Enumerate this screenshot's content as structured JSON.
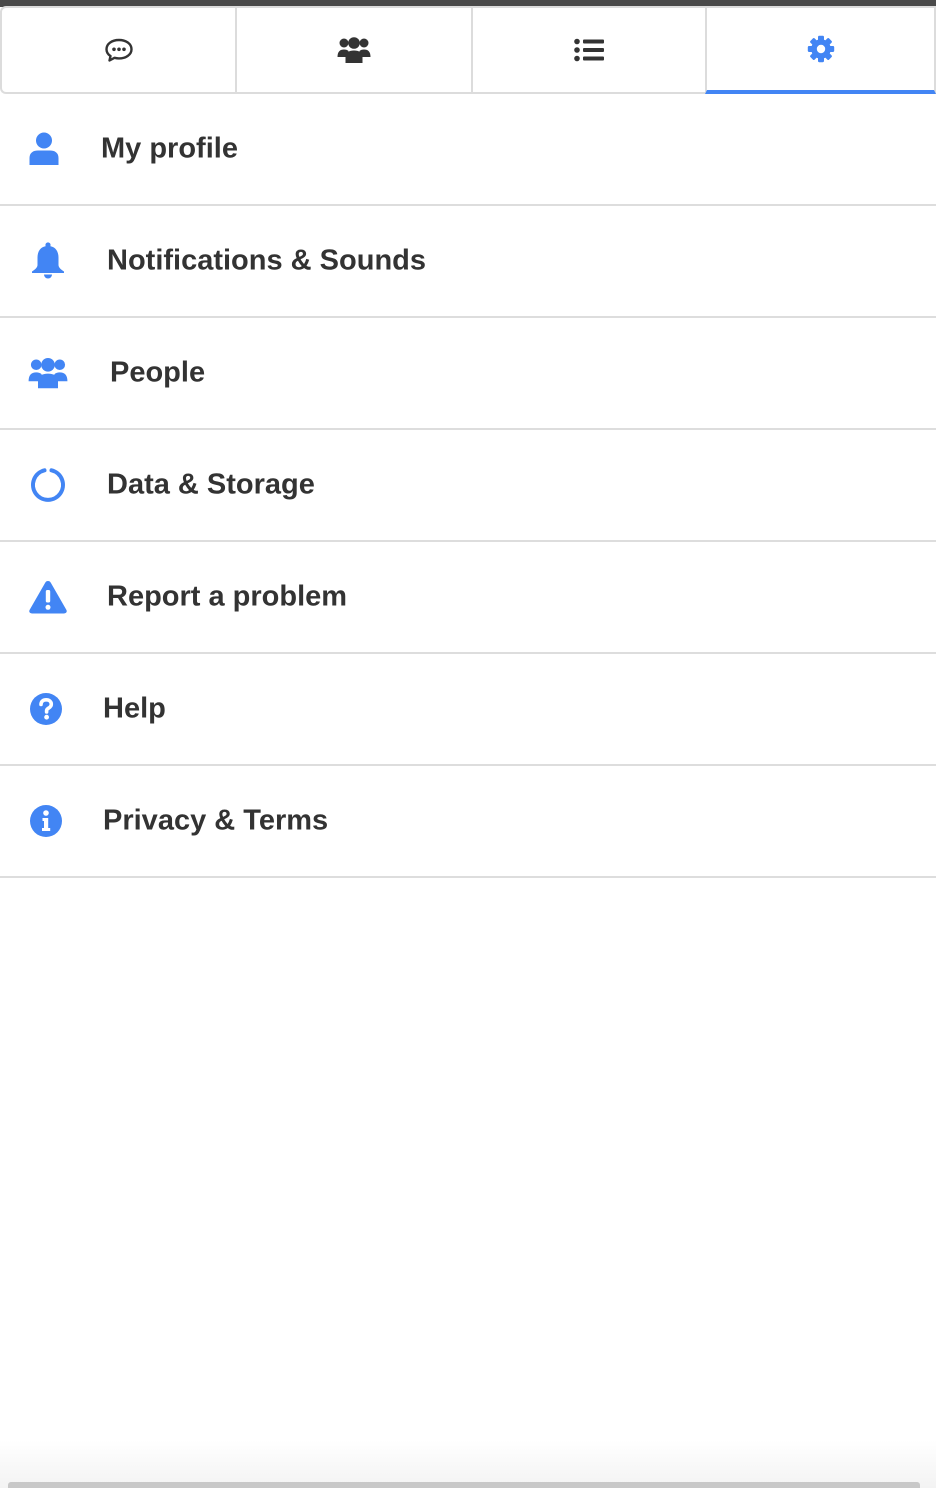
{
  "tabs": [
    {
      "icon": "chat-bubble-icon",
      "active": false
    },
    {
      "icon": "users-icon",
      "active": false
    },
    {
      "icon": "list-icon",
      "active": false
    },
    {
      "icon": "gear-icon",
      "active": true
    }
  ],
  "menu": {
    "items": [
      {
        "icon": "user-icon",
        "label": "My profile"
      },
      {
        "icon": "bell-icon",
        "label": "Notifications & Sounds"
      },
      {
        "icon": "users-icon",
        "label": "People"
      },
      {
        "icon": "circle-notch-icon",
        "label": "Data & Storage"
      },
      {
        "icon": "warning-icon",
        "label": "Report a problem"
      },
      {
        "icon": "question-circle-icon",
        "label": "Help"
      },
      {
        "icon": "info-circle-icon",
        "label": "Privacy & Terms"
      }
    ]
  },
  "colors": {
    "accent": "#4285f4",
    "text": "#333333",
    "divider": "#dddddd"
  }
}
